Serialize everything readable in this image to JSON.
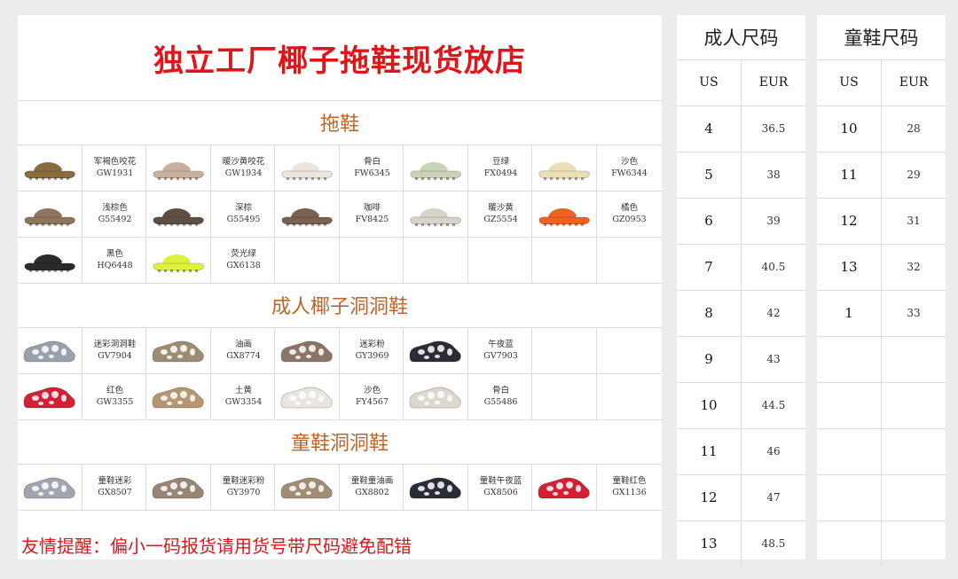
{
  "store_title": "独立工厂椰子拖鞋现货放店",
  "sections": [
    {
      "title": "拖鞋",
      "rows": [
        [
          {
            "name": "军褐色咬花",
            "code": "GW1931",
            "color": "#8a6b3e",
            "style": "slide"
          },
          {
            "name": "暖沙黄咬花",
            "code": "GW1934",
            "color": "#c9b09c",
            "style": "slide"
          },
          {
            "name": "骨白",
            "code": "FW6345",
            "color": "#ebe6dd",
            "style": "slide"
          },
          {
            "name": "豆绿",
            "code": "FX0494",
            "color": "#c9d3b6",
            "style": "slide"
          },
          {
            "name": "沙色",
            "code": "FW6344",
            "color": "#ecdfb6",
            "style": "slide"
          }
        ],
        [
          {
            "name": "浅棕色",
            "code": "G55492",
            "color": "#8d7659",
            "style": "slide"
          },
          {
            "name": "深棕",
            "code": "G55495",
            "color": "#5e4f44",
            "style": "slide"
          },
          {
            "name": "咖啡",
            "code": "FV8425",
            "color": "#7a6150",
            "style": "slide"
          },
          {
            "name": "暖沙黄",
            "code": "GZ5554",
            "color": "#d8d3c8",
            "style": "slide"
          },
          {
            "name": "橘色",
            "code": "GZ0953",
            "color": "#f0621e",
            "style": "slide"
          }
        ],
        [
          {
            "name": "黑色",
            "code": "HQ6448",
            "color": "#2a2a2a",
            "style": "slide"
          },
          {
            "name": "荧光绿",
            "code": "GX6138",
            "color": "#dff23a",
            "style": "slide"
          }
        ]
      ]
    },
    {
      "title": "成人椰子洞洞鞋",
      "rows": [
        [
          {
            "name": "迷彩洞洞鞋",
            "code": "GV7904",
            "color": "#9aa0ab",
            "style": "foam"
          },
          {
            "name": "油画",
            "code": "GX8774",
            "color": "#9c8c73",
            "style": "foam"
          },
          {
            "name": "迷彩粉",
            "code": "GY3969",
            "color": "#8a7566",
            "style": "foam"
          },
          {
            "name": "午夜蓝",
            "code": "GV7903",
            "color": "#2b2d36",
            "style": "foam"
          }
        ],
        [
          {
            "name": "红色",
            "code": "GW3355",
            "color": "#d32035",
            "style": "foam"
          },
          {
            "name": "土黄",
            "code": "GW3354",
            "color": "#b59670",
            "style": "foam"
          },
          {
            "name": "沙色",
            "code": "FY4567",
            "color": "#e9e6df",
            "style": "foam"
          },
          {
            "name": "骨白",
            "code": "G55486",
            "color": "#ddd8ce",
            "style": "foam"
          }
        ]
      ]
    },
    {
      "title": "童鞋洞洞鞋",
      "rows": [
        [
          {
            "name": "童鞋迷彩",
            "code": "GX8507",
            "color": "#a0a6ae",
            "style": "foam"
          },
          {
            "name": "童鞋迷彩粉",
            "code": "GY3970",
            "color": "#978676",
            "style": "foam"
          },
          {
            "name": "童鞋童油画",
            "code": "GX8802",
            "color": "#a08d74",
            "style": "foam"
          },
          {
            "name": "童鞋午夜蓝",
            "code": "GX8506",
            "color": "#2b2d36",
            "style": "foam"
          },
          {
            "name": "童鞋红色",
            "code": "GX1136",
            "color": "#d32035",
            "style": "foam"
          }
        ]
      ]
    }
  ],
  "reminder": "友情提醒：偏小一码报货请用货号带尺码避免配错",
  "adult_sizes": {
    "title": "成人尺码",
    "col_us": "US",
    "col_eur": "EUR",
    "rows": [
      {
        "us": "4",
        "eur": "36.5"
      },
      {
        "us": "5",
        "eur": "38"
      },
      {
        "us": "6",
        "eur": "39"
      },
      {
        "us": "7",
        "eur": "40.5"
      },
      {
        "us": "8",
        "eur": "42"
      },
      {
        "us": "9",
        "eur": "43"
      },
      {
        "us": "10",
        "eur": "44.5"
      },
      {
        "us": "11",
        "eur": "46"
      },
      {
        "us": "12",
        "eur": "47"
      },
      {
        "us": "13",
        "eur": "48.5"
      }
    ]
  },
  "kids_sizes": {
    "title": "童鞋尺码",
    "col_us": "US",
    "col_eur": "EUR",
    "rows": [
      {
        "us": "10",
        "eur": "28"
      },
      {
        "us": "11",
        "eur": "29"
      },
      {
        "us": "12",
        "eur": "31"
      },
      {
        "us": "13",
        "eur": "32"
      },
      {
        "us": "1",
        "eur": "33"
      }
    ]
  },
  "colors": {
    "title_red": "#e0151a",
    "section_orange": "#c0652a",
    "grid_line": "#dddddd"
  }
}
